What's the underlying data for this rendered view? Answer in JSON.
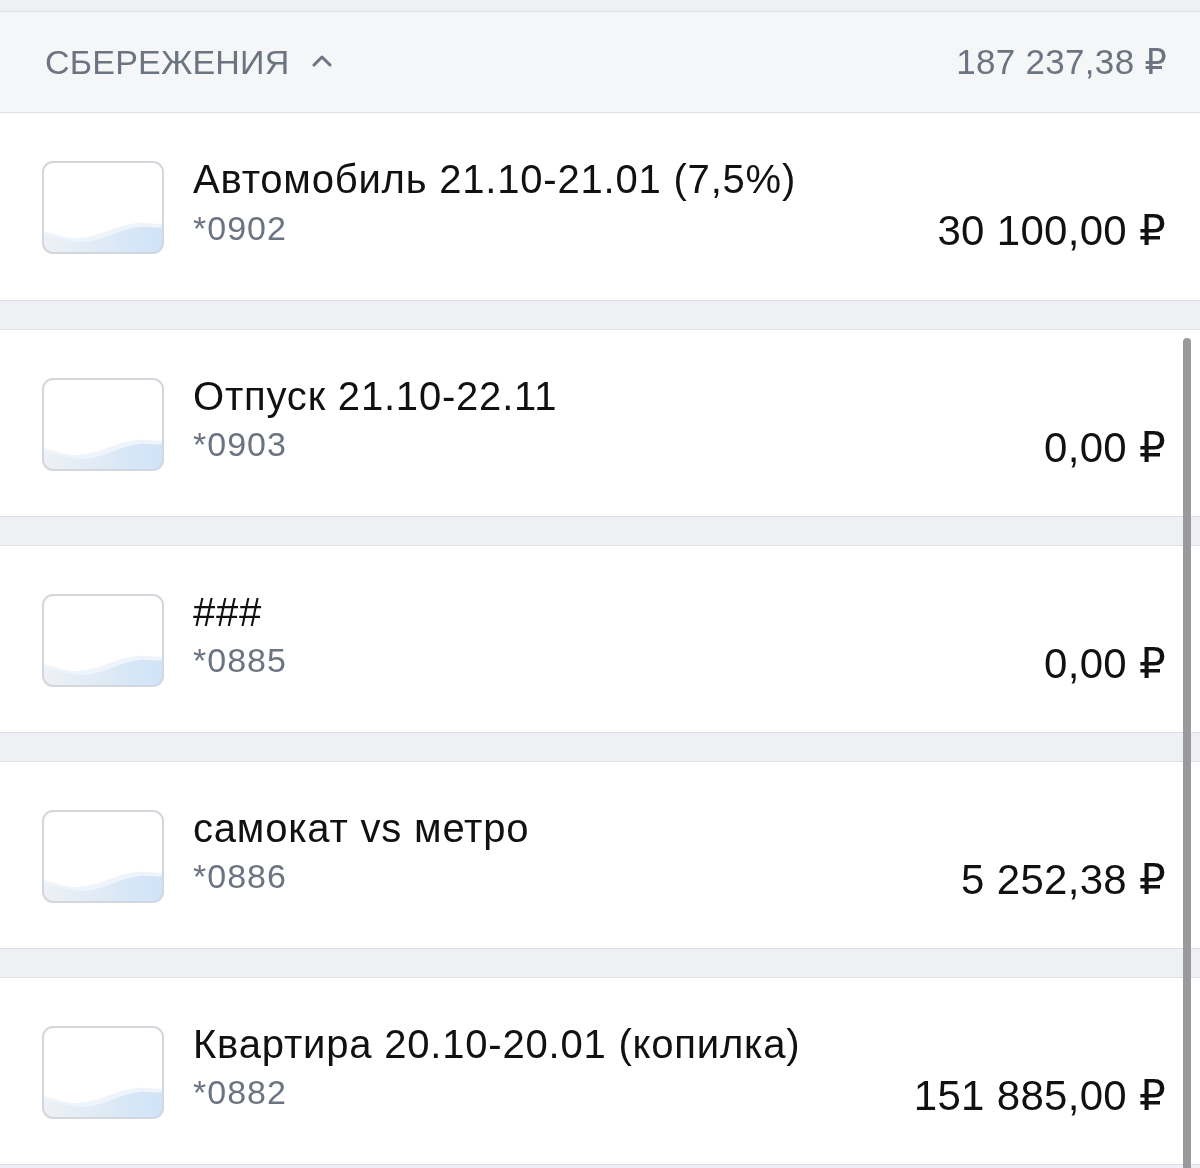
{
  "section": {
    "title": "СБЕРЕЖЕНИЯ",
    "expanded": true,
    "total": "187 237,38 ₽"
  },
  "accounts": [
    {
      "name": "Автомобиль 21.10-21.01 (7,5%)",
      "number": "*0902",
      "balance": "30 100,00 ₽"
    },
    {
      "name": "Отпуск 21.10-22.11",
      "number": "*0903",
      "balance": "0,00 ₽"
    },
    {
      "name": "###",
      "number": "*0885",
      "balance": "0,00 ₽"
    },
    {
      "name": "самокат vs метро",
      "number": "*0886",
      "balance": "5 252,38 ₽"
    },
    {
      "name": "Квартира 20.10-20.01 (копилка)",
      "number": "*0882",
      "balance": "151 885,00 ₽"
    }
  ]
}
